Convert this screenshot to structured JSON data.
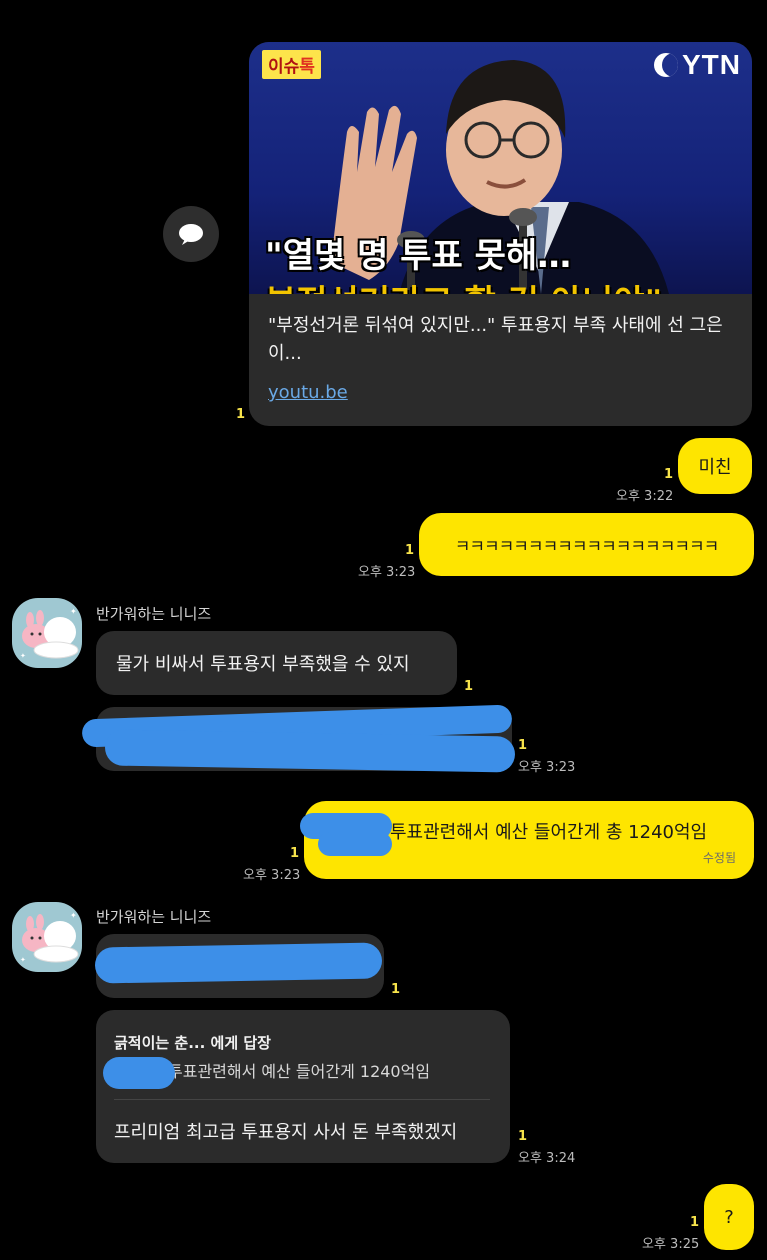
{
  "share_button": {
    "icon": "speech-bubble-icon"
  },
  "link_card": {
    "thumbnail": {
      "badge_prefix": "이슈",
      "badge_suffix": "톡",
      "logo": "YTN",
      "headline_line1": "\"열몇 명 투표 못해…",
      "headline_line2": "부정선거라고 할 건 아니야\""
    },
    "title": "\"부정선거론 뒤섞여 있지만...\" 투표용지 부족 사태에 선 그은 이...",
    "domain": "youtu.be",
    "unread": "1"
  },
  "messages": {
    "m1": {
      "text": "미친",
      "unread": "1",
      "time": "오후 3:22"
    },
    "m2": {
      "text": "ㅋㅋㅋㅋㅋㅋㅋㅋㅋㅋㅋㅋㅋㅋㅋㅋㅋㅋ",
      "unread": "1",
      "time": "오후 3:23"
    },
    "m3": {
      "sender": "반가워하는 니니즈",
      "text": "물가 비싸서 투표용지 부족했을 수 있지",
      "unread": "1"
    },
    "m4": {
      "unread": "1",
      "time": "오후 3:23"
    },
    "m5": {
      "text": "투표관련해서 예산 들어간게 총 1240억임",
      "edited": "수정됨",
      "unread": "1",
      "time": "오후 3:23"
    },
    "m6": {
      "sender": "반가워하는 니니즈",
      "unread": "1"
    },
    "m7": {
      "reply_to": "긁적이는 춘... 에게 답장",
      "quoted": "투표관련해서 예산 들어간게 1240억임",
      "text": "프리미엄 최고급 투표용지 사서 돈 부족했겠지",
      "unread": "1",
      "time": "오후 3:24"
    },
    "m8": {
      "text": "?",
      "unread": "1",
      "time": "오후 3:25"
    }
  },
  "colors": {
    "my_bubble": "#fee500",
    "other_bubble": "#2b2b2b",
    "unread": "#f7e34b",
    "redaction": "#3d8fe8"
  }
}
